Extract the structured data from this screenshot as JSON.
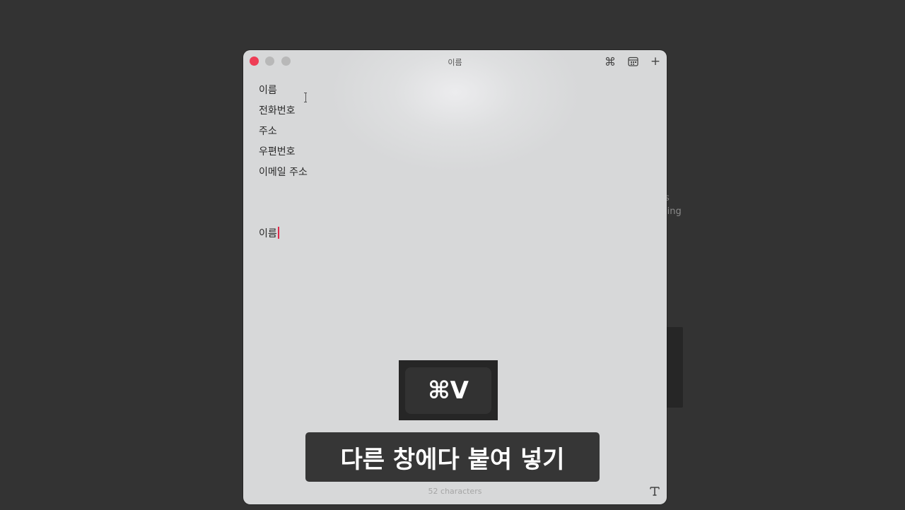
{
  "background_window": {
    "text_line_1": "s",
    "text_line_2": "ling"
  },
  "window": {
    "title": "이름",
    "icons": [
      "command-icon",
      "calendar-icon",
      "plus-icon"
    ]
  },
  "editor": {
    "lines": [
      "이름",
      "전화번호",
      "주소",
      "우편번호",
      "이메일 주소"
    ],
    "current_line": "이름"
  },
  "footer": {
    "character_count": "52 characters",
    "format_icon": "text-format-icon"
  },
  "overlay": {
    "shortcut": "⌘V",
    "caption": "다른 창에다 붙여 넣기"
  },
  "colors": {
    "desktop": "#333333",
    "window": "#d7d8d9",
    "close_button": "#ee3d55",
    "caret": "#e0284a"
  }
}
